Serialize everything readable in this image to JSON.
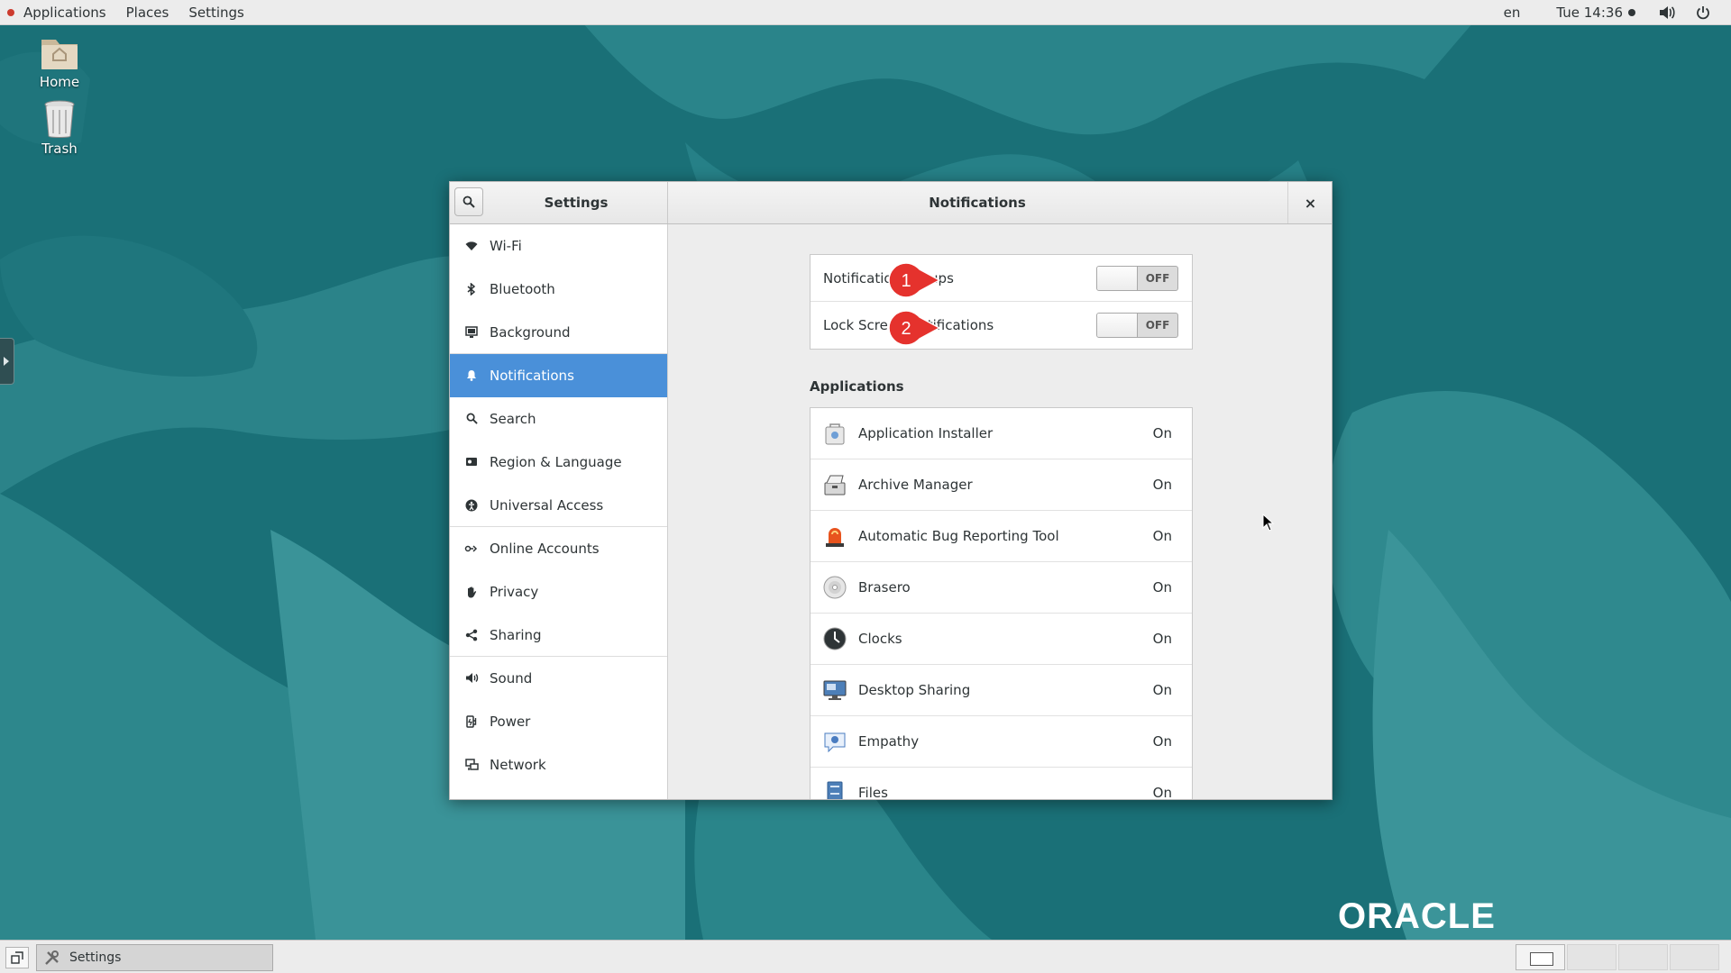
{
  "top_panel": {
    "menus": [
      "Applications",
      "Places",
      "Settings"
    ],
    "language": "en",
    "clock": "Tue 14:36",
    "icons": [
      "volume-icon",
      "power-icon"
    ]
  },
  "desktop": {
    "icons": [
      {
        "label": "Home",
        "icon": "home-folder-icon"
      },
      {
        "label": "Trash",
        "icon": "trash-icon"
      }
    ],
    "logo": "ORACLE"
  },
  "window": {
    "sidebar_title": "Settings",
    "page_title": "Notifications",
    "close": "×"
  },
  "sidebar": {
    "items": [
      {
        "label": "Wi-Fi",
        "icon": "wifi-icon"
      },
      {
        "label": "Bluetooth",
        "icon": "bluetooth-icon"
      },
      {
        "label": "Background",
        "icon": "background-icon"
      },
      {
        "label": "Notifications",
        "icon": "bell-icon",
        "selected": true
      },
      {
        "label": "Search",
        "icon": "search-icon"
      },
      {
        "label": "Region & Language",
        "icon": "region-icon"
      },
      {
        "label": "Universal Access",
        "icon": "accessibility-icon"
      },
      {
        "label": "Online Accounts",
        "icon": "online-accounts-icon"
      },
      {
        "label": "Privacy",
        "icon": "hand-icon"
      },
      {
        "label": "Sharing",
        "icon": "share-icon"
      },
      {
        "label": "Sound",
        "icon": "speaker-icon"
      },
      {
        "label": "Power",
        "icon": "power-plug-icon"
      },
      {
        "label": "Network",
        "icon": "network-icon"
      }
    ]
  },
  "notifications": {
    "settings": [
      {
        "label": "Notification Popups",
        "state": "OFF",
        "callout": "1"
      },
      {
        "label": "Lock Screen Notifications",
        "state": "OFF",
        "callout": "2"
      }
    ],
    "applications_title": "Applications",
    "applications": [
      {
        "name": "Application Installer",
        "state": "On",
        "icon": "package-icon"
      },
      {
        "name": "Archive Manager",
        "state": "On",
        "icon": "archive-icon"
      },
      {
        "name": "Automatic Bug Reporting Tool",
        "state": "On",
        "icon": "alarm-light-icon"
      },
      {
        "name": "Brasero",
        "state": "On",
        "icon": "disc-icon"
      },
      {
        "name": "Clocks",
        "state": "On",
        "icon": "clock-icon"
      },
      {
        "name": "Desktop Sharing",
        "state": "On",
        "icon": "monitor-icon"
      },
      {
        "name": "Empathy",
        "state": "On",
        "icon": "chat-icon"
      },
      {
        "name": "Files",
        "state": "On",
        "icon": "file-cabinet-icon"
      }
    ]
  },
  "taskbar": {
    "task_label": "Settings",
    "workspaces": 4,
    "active_workspace": 1
  },
  "colors": {
    "accent": "#4a90d9",
    "callout": "#e5322d",
    "desktop": "#1a7077"
  }
}
